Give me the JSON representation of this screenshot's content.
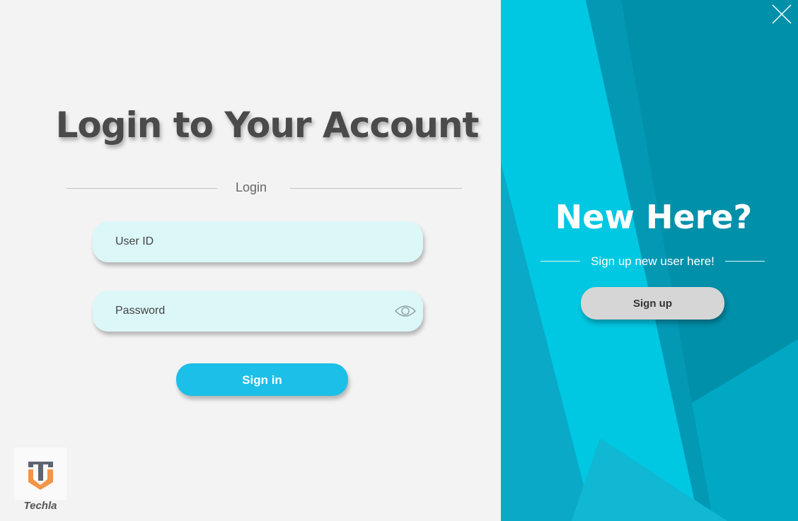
{
  "login": {
    "title": "Login to Your Account",
    "section_label": "Login",
    "user_placeholder": "User ID",
    "password_placeholder": "Password",
    "signin_label": "Sign in"
  },
  "signup": {
    "title": "New Here?",
    "subtitle": "Sign up new user here!",
    "button_label": "Sign up"
  },
  "logo": {
    "text": "Techla"
  },
  "colors": {
    "accent": "#1bbfe8",
    "panel": "#00b6d3"
  }
}
